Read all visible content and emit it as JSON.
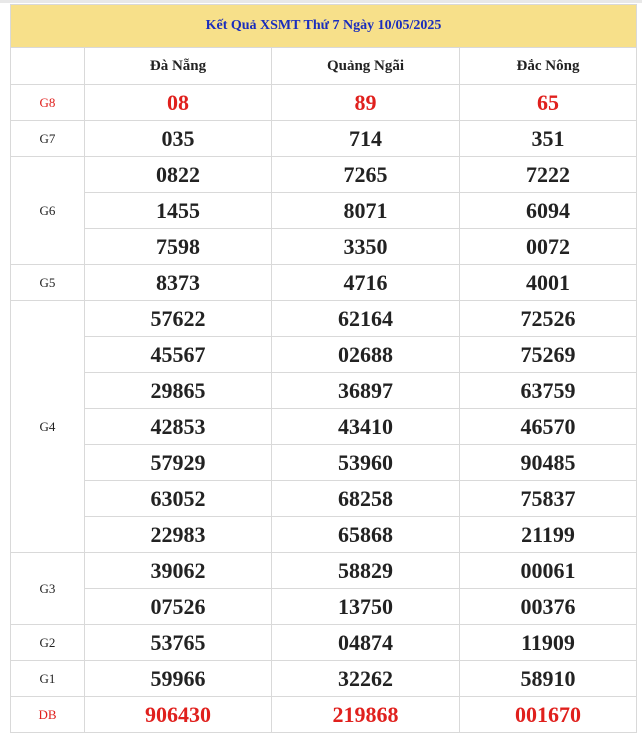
{
  "title": "Kết Quả XSMT Thứ 7 Ngày 10/05/2025",
  "provinces": [
    "Đà Nẵng",
    "Quảng Ngãi",
    "Đắc Nông"
  ],
  "prizes": [
    {
      "label": "G8",
      "red": true,
      "rows": [
        [
          "08",
          "89",
          "65"
        ]
      ]
    },
    {
      "label": "G7",
      "red": false,
      "rows": [
        [
          "035",
          "714",
          "351"
        ]
      ]
    },
    {
      "label": "G6",
      "red": false,
      "rows": [
        [
          "0822",
          "7265",
          "7222"
        ],
        [
          "1455",
          "8071",
          "6094"
        ],
        [
          "7598",
          "3350",
          "0072"
        ]
      ]
    },
    {
      "label": "G5",
      "red": false,
      "rows": [
        [
          "8373",
          "4716",
          "4001"
        ]
      ]
    },
    {
      "label": "G4",
      "red": false,
      "rows": [
        [
          "57622",
          "62164",
          "72526"
        ],
        [
          "45567",
          "02688",
          "75269"
        ],
        [
          "29865",
          "36897",
          "63759"
        ],
        [
          "42853",
          "43410",
          "46570"
        ],
        [
          "57929",
          "53960",
          "90485"
        ],
        [
          "63052",
          "68258",
          "75837"
        ],
        [
          "22983",
          "65868",
          "21199"
        ]
      ]
    },
    {
      "label": "G3",
      "red": false,
      "rows": [
        [
          "39062",
          "58829",
          "00061"
        ],
        [
          "07526",
          "13750",
          "00376"
        ]
      ]
    },
    {
      "label": "G2",
      "red": false,
      "rows": [
        [
          "53765",
          "04874",
          "11909"
        ]
      ]
    },
    {
      "label": "G1",
      "red": false,
      "rows": [
        [
          "59966",
          "32262",
          "58910"
        ]
      ]
    },
    {
      "label": "DB",
      "red": true,
      "rows": [
        [
          "906430",
          "219868",
          "001670"
        ]
      ]
    }
  ]
}
